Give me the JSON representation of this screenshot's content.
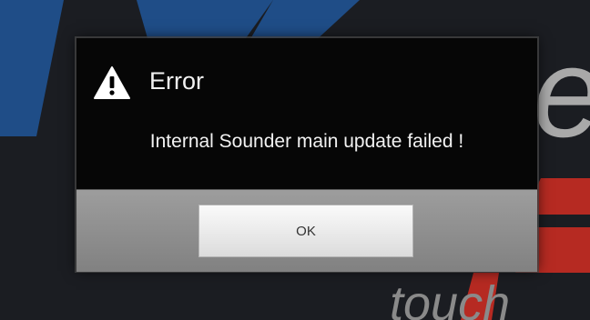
{
  "background": {
    "logo_text": "touch"
  },
  "dialog": {
    "title": "Error",
    "icon": "warning-icon",
    "message": "Internal Sounder main update failed !",
    "ok_label": "OK"
  },
  "colors": {
    "dialog_bg": "#060606",
    "button_bar": "#8f8f8f",
    "brand_blue": "#1f4d87",
    "brand_red": "#b62a22"
  }
}
